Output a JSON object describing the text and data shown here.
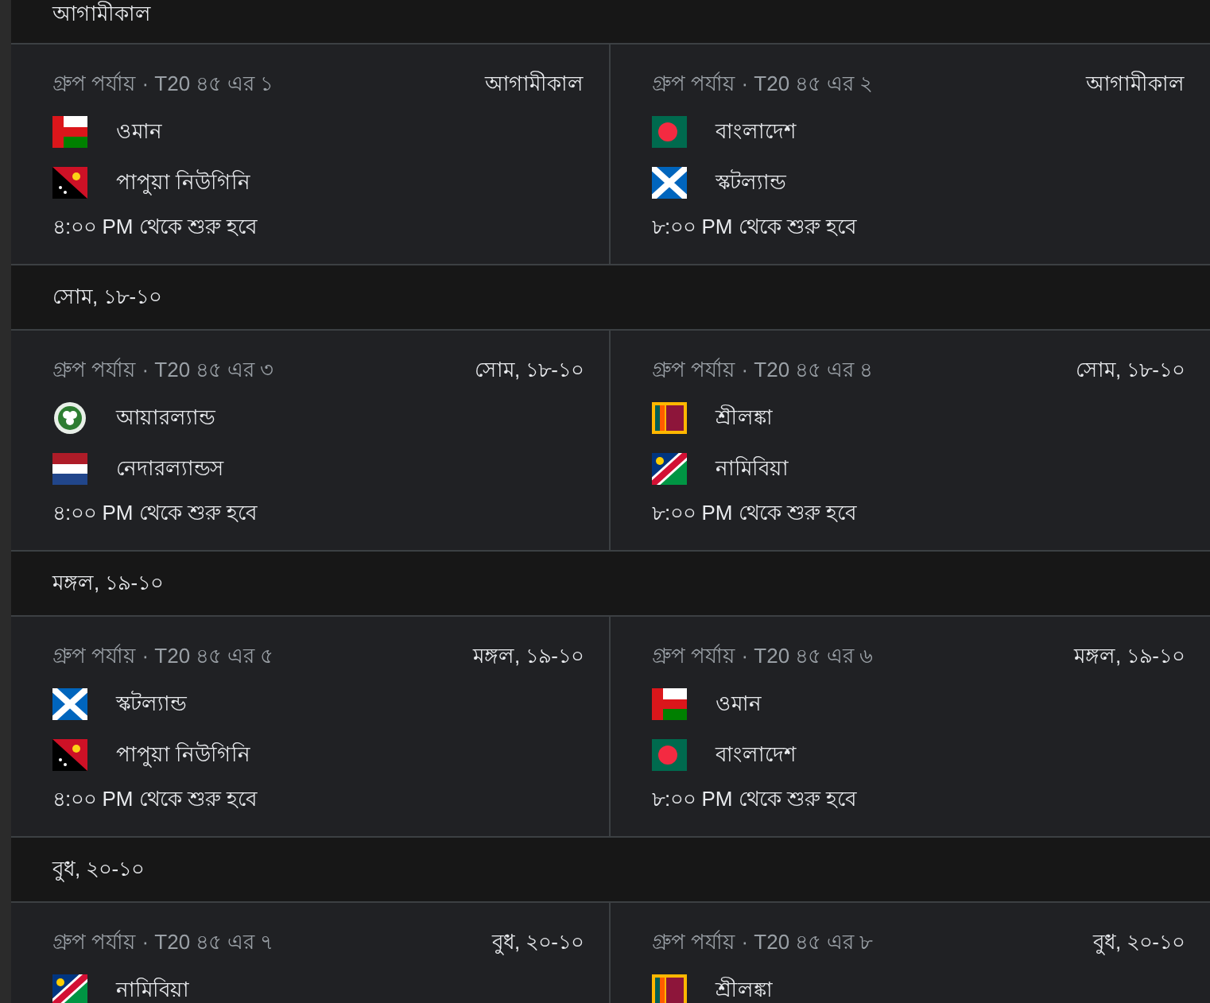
{
  "days": [
    {
      "label": "আগামীকাল",
      "matches": [
        {
          "stage": "গ্রুপ পর্যায় · T20 ৪৫ এর ১",
          "date": "আগামীকাল",
          "teams": [
            {
              "name": "ওমান",
              "kind": "oman"
            },
            {
              "name": "পাপুয়া নিউগিনি",
              "kind": "png"
            }
          ],
          "time": "৪:০০ PM থেকে শুরু হবে"
        },
        {
          "stage": "গ্রুপ পর্যায় · T20 ৪৫ এর ২",
          "date": "আগামীকাল",
          "teams": [
            {
              "name": "বাংলাদেশ",
              "kind": "bangladesh"
            },
            {
              "name": "স্কটল্যান্ড",
              "kind": "scotland"
            }
          ],
          "time": "৮:০০ PM থেকে শুরু হবে"
        }
      ]
    },
    {
      "label": "সোম, ১৮-১০",
      "matches": [
        {
          "stage": "গ্রুপ পর্যায় · T20 ৪৫ এর ৩",
          "date": "সোম, ১৮-১০",
          "teams": [
            {
              "name": "আয়ারল্যান্ড",
              "kind": "ireland"
            },
            {
              "name": "নেদারল্যান্ডস",
              "kind": "netherlands"
            }
          ],
          "time": "৪:০০ PM থেকে শুরু হবে"
        },
        {
          "stage": "গ্রুপ পর্যায় · T20 ৪৫ এর ৪",
          "date": "সোম, ১৮-১০",
          "teams": [
            {
              "name": "শ্রীলঙ্কা",
              "kind": "srilanka"
            },
            {
              "name": "নামিবিয়া",
              "kind": "namibia"
            }
          ],
          "time": "৮:০০ PM থেকে শুরু হবে"
        }
      ]
    },
    {
      "label": "মঙ্গল, ১৯-১০",
      "matches": [
        {
          "stage": "গ্রুপ পর্যায় · T20 ৪৫ এর ৫",
          "date": "মঙ্গল, ১৯-১০",
          "teams": [
            {
              "name": "স্কটল্যান্ড",
              "kind": "scotland"
            },
            {
              "name": "পাপুয়া নিউগিনি",
              "kind": "png"
            }
          ],
          "time": "৪:০০ PM থেকে শুরু হবে"
        },
        {
          "stage": "গ্রুপ পর্যায় · T20 ৪৫ এর ৬",
          "date": "মঙ্গল, ১৯-১০",
          "teams": [
            {
              "name": "ওমান",
              "kind": "oman"
            },
            {
              "name": "বাংলাদেশ",
              "kind": "bangladesh"
            }
          ],
          "time": "৮:০০ PM থেকে শুরু হবে"
        }
      ]
    },
    {
      "label": "বুধ, ২০-১০",
      "matches": [
        {
          "stage": "গ্রুপ পর্যায় · T20 ৪৫ এর ৭",
          "date": "বুধ, ২০-১০",
          "teams": [
            {
              "name": "নামিবিয়া",
              "kind": "namibia"
            }
          ]
        },
        {
          "stage": "গ্রুপ পর্যায় · T20 ৪৫ এর ৮",
          "date": "বুধ, ২০-১০",
          "teams": [
            {
              "name": "শ্রীলঙ্কা",
              "kind": "srilanka"
            }
          ]
        }
      ]
    }
  ]
}
